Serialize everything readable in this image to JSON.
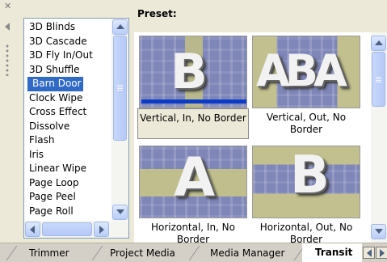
{
  "transitions": {
    "items": [
      {
        "label": "3D Blinds"
      },
      {
        "label": "3D Cascade"
      },
      {
        "label": "3D Fly In/Out"
      },
      {
        "label": "3D Shuffle"
      },
      {
        "label": "Barn Door"
      },
      {
        "label": "Clock Wipe"
      },
      {
        "label": "Cross Effect"
      },
      {
        "label": "Dissolve"
      },
      {
        "label": "Flash"
      },
      {
        "label": "Iris"
      },
      {
        "label": "Linear Wipe"
      },
      {
        "label": "Page Loop"
      },
      {
        "label": "Page Peel"
      },
      {
        "label": "Page Roll"
      }
    ],
    "selected": "Barn Door"
  },
  "preset": {
    "title": "Preset:",
    "items": [
      {
        "label": "Vertical, In, No Border",
        "glyph": "B"
      },
      {
        "label": "Vertical, Out, No Border",
        "glyph": "ABA"
      },
      {
        "label": "Horizontal, In, No Border",
        "glyph": "A"
      },
      {
        "label": "Horizontal, Out, No Border",
        "glyph": "B"
      }
    ],
    "selected": "Vertical, In, No Border",
    "preview_progress": 1.0
  },
  "tabs": [
    {
      "label": "Trimmer"
    },
    {
      "label": "Project Media"
    },
    {
      "label": "Media Manager"
    },
    {
      "label": "Transit"
    }
  ],
  "active_tab": "Transit",
  "colors": {
    "selection": "#316ac5",
    "progress": "#0a3cc8",
    "scrollbar": "#b8cdf8"
  }
}
